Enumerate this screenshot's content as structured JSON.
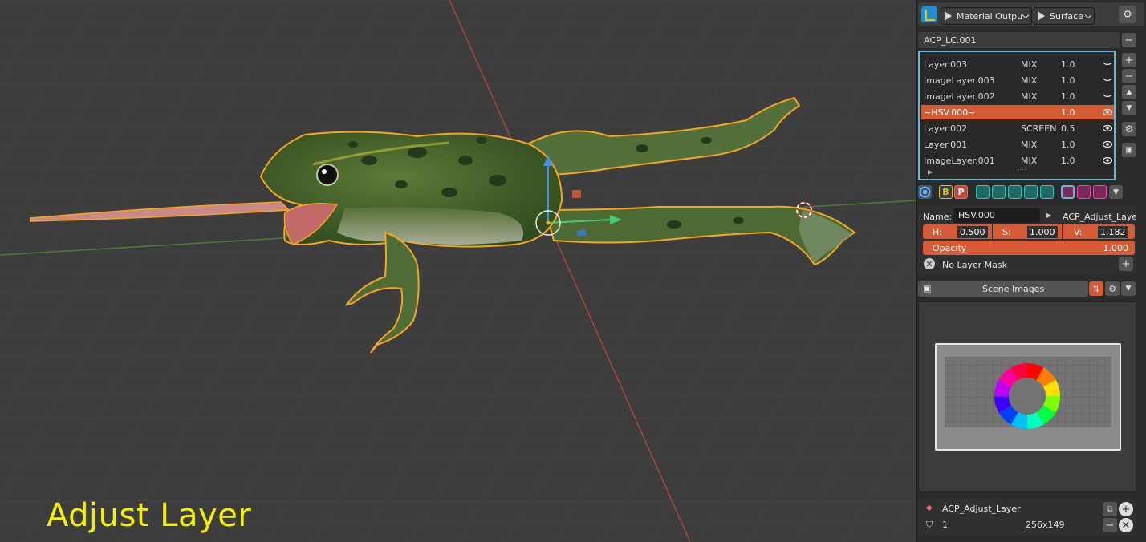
{
  "viewport": {
    "overlay_text": "Adjust Layer"
  },
  "header": {
    "output_node": "Material Outpu",
    "output_target": "Surface"
  },
  "material_slot": {
    "name": "ACP_LC.001",
    "minus_label": "−"
  },
  "layers": [
    {
      "name": "Layer.003",
      "mode": "MIX",
      "value": "1.0",
      "visible": false,
      "active": false
    },
    {
      "name": "ImageLayer.003",
      "mode": "MIX",
      "value": "1.0",
      "visible": false,
      "active": false
    },
    {
      "name": "ImageLayer.002",
      "mode": "MIX",
      "value": "1.0",
      "visible": false,
      "active": false
    },
    {
      "name": "~HSV.000~",
      "mode": "",
      "value": "1.0",
      "visible": true,
      "active": true
    },
    {
      "name": "Layer.002",
      "mode": "SCREEN",
      "value": "0.5",
      "visible": true,
      "active": false
    },
    {
      "name": "Layer.001",
      "mode": "MIX",
      "value": "1.0",
      "visible": true,
      "active": false
    },
    {
      "name": "ImageLayer.001",
      "mode": "MIX",
      "value": "1.0",
      "visible": true,
      "active": false
    }
  ],
  "list_controls": {
    "add": "+",
    "remove": "−",
    "up": "▲",
    "down": "▼",
    "grip": "::::"
  },
  "toolbar": {
    "b_label": "B",
    "p_label": "P"
  },
  "properties": {
    "name_label": "Name:",
    "name_value": "HSV.000",
    "node_group": "ACP_Adjust_Laye",
    "h_label": "H:",
    "h_value": "0.500",
    "s_label": "S:",
    "s_value": "1.000",
    "v_label": "V:",
    "v_value": "1.182",
    "opacity_label": "Opacity",
    "opacity_value": "1.000",
    "mask_label": "No Layer Mask"
  },
  "images": {
    "header_label": "Scene Images"
  },
  "footer": {
    "image_name": "ACP_Adjust_Layer",
    "users": "1",
    "resolution": "256x149"
  },
  "colors": {
    "accent": "#d55a36",
    "selection": "#f5a623",
    "list_border": "#67b6d6",
    "overlay_text": "#f5f000"
  }
}
